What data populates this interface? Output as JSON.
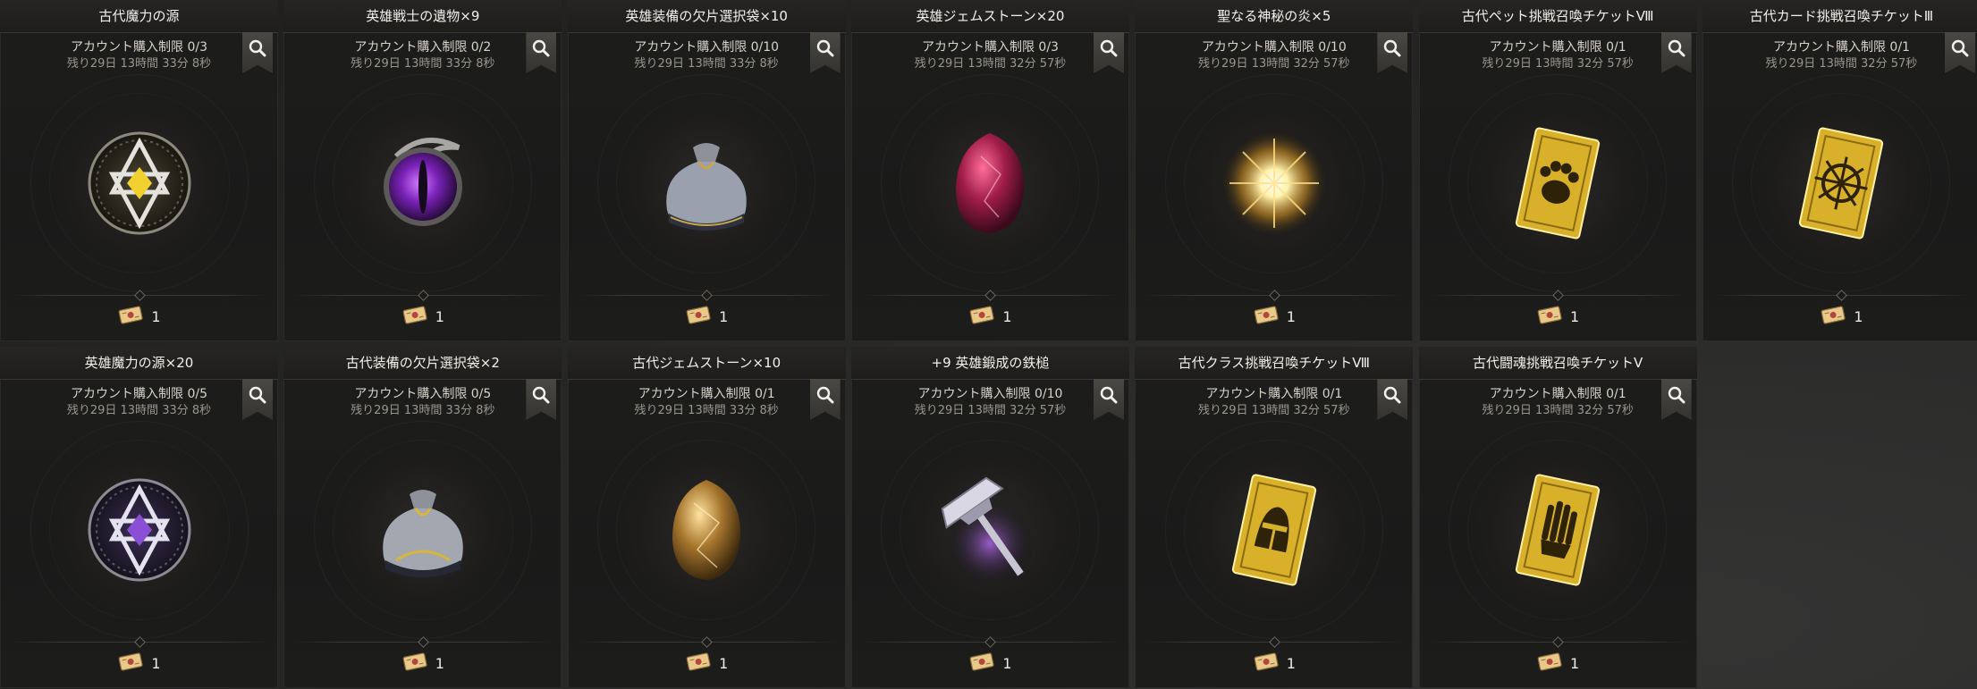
{
  "shop": {
    "items": [
      {
        "name": "古代魔力の源",
        "limit": "アカウント購入制限 0/3",
        "remaining": "残り29日 13時間 33分 8秒",
        "price": "1",
        "icon": "star-seal-gold-icon"
      },
      {
        "name": "英雄戦士の遺物×9",
        "limit": "アカウント購入制限 0/2",
        "remaining": "残り29日 13時間 33分 8秒",
        "price": "1",
        "icon": "dragon-eye-icon"
      },
      {
        "name": "英雄装備の欠片選択袋×10",
        "limit": "アカウント購入制限 0/10",
        "remaining": "残り29日 13時間 33分 8秒",
        "price": "1",
        "icon": "pouch-icon"
      },
      {
        "name": "英雄ジェムストーン×20",
        "limit": "アカウント購入制限 0/3",
        "remaining": "残り29日 13時間 32分 57秒",
        "price": "1",
        "icon": "red-gemstone-icon"
      },
      {
        "name": "聖なる神秘の炎×5",
        "limit": "アカウント購入制限 0/10",
        "remaining": "残り29日 13時間 32分 57秒",
        "price": "1",
        "icon": "holy-flame-icon"
      },
      {
        "name": "古代ペット挑戦召喚チケットⅧ",
        "limit": "アカウント購入制限 0/1",
        "remaining": "残り29日 13時間 32分 57秒",
        "price": "1",
        "icon": "pet-ticket-icon"
      },
      {
        "name": "古代カード挑戦召喚チケットⅢ",
        "limit": "アカウント購入制限 0/1",
        "remaining": "残り29日 13時間 32分 57秒",
        "price": "1",
        "icon": "card-ticket-icon"
      },
      {
        "name": "英雄魔力の源×20",
        "limit": "アカウント購入制限 0/5",
        "remaining": "残り29日 13時間 33分 8秒",
        "price": "1",
        "icon": "star-seal-purple-icon"
      },
      {
        "name": "古代装備の欠片選択袋×2",
        "limit": "アカウント購入制限 0/5",
        "remaining": "残り29日 13時間 33分 8秒",
        "price": "1",
        "icon": "pouch-gold-icon"
      },
      {
        "name": "古代ジェムストーン×10",
        "limit": "アカウント購入制限 0/1",
        "remaining": "残り29日 13時間 33分 8秒",
        "price": "1",
        "icon": "gold-gemstone-icon"
      },
      {
        "name": "+9 英雄鍛成の鉄槌",
        "limit": "アカウント購入制限 0/10",
        "remaining": "残り29日 13時間 32分 57秒",
        "price": "1",
        "icon": "forging-hammer-icon"
      },
      {
        "name": "古代クラス挑戦召喚チケットⅧ",
        "limit": "アカウント購入制限 0/1",
        "remaining": "残り29日 13時間 32分 57秒",
        "price": "1",
        "icon": "class-ticket-icon"
      },
      {
        "name": "古代闘魂挑戦召喚チケットⅤ",
        "limit": "アカウント購入制限 0/1",
        "remaining": "残り29日 13時間 32分 57秒",
        "price": "1",
        "icon": "spirit-ticket-icon"
      }
    ]
  },
  "colors": {
    "title_text": "#f2f0ea",
    "limit_text": "#d7d3c9",
    "timer_text": "#9a968e",
    "gold": "#d9b53a"
  }
}
